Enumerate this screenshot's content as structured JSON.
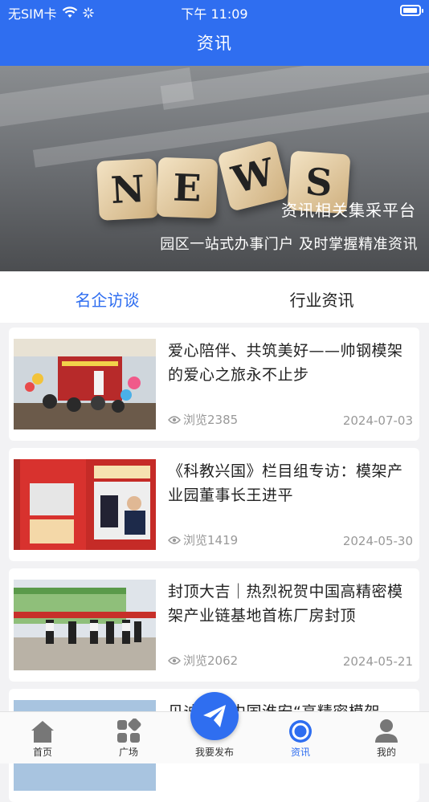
{
  "status_bar": {
    "carrier": "无SIM卡",
    "time": "下午 11:09"
  },
  "nav": {
    "title": "资讯"
  },
  "banner": {
    "dice_letters": [
      "N",
      "E",
      "W",
      "S"
    ],
    "caption_line1": "资讯相关集采平台",
    "caption_line2": "园区一站式办事门户 及时掌握精准资讯"
  },
  "tabs": [
    {
      "label": "名企访谈",
      "active": true
    },
    {
      "label": "行业资讯",
      "active": false
    }
  ],
  "articles": [
    {
      "title": "爱心陪伴、共筑美好——帅钢模架的爱心之旅永不止步",
      "views": "浏览2385",
      "date": "2024-07-03"
    },
    {
      "title": "《科教兴国》栏目组专访：模架产业园董事长王进平",
      "views": "浏览1419",
      "date": "2024-05-30"
    },
    {
      "title": "封顶大吉｜热烈祝贺中国高精密模架产业链基地首栋厂房封顶",
      "views": "浏览2062",
      "date": "2024-05-21"
    },
    {
      "title": "贝迪……中国淮安“高精密模架",
      "views": "",
      "date": ""
    }
  ],
  "tabbar": [
    {
      "label": "首页",
      "icon": "home-icon",
      "active": false
    },
    {
      "label": "广场",
      "icon": "grid-icon",
      "active": false
    },
    {
      "label": "我要发布",
      "icon": "paper-plane-icon",
      "active": false
    },
    {
      "label": "资讯",
      "icon": "info-circle-icon",
      "active": true
    },
    {
      "label": "我的",
      "icon": "user-icon",
      "active": false
    }
  ],
  "colors": {
    "brand": "#2f6ef0",
    "text": "#222222",
    "muted": "#999999",
    "background": "#f2f2f4"
  }
}
